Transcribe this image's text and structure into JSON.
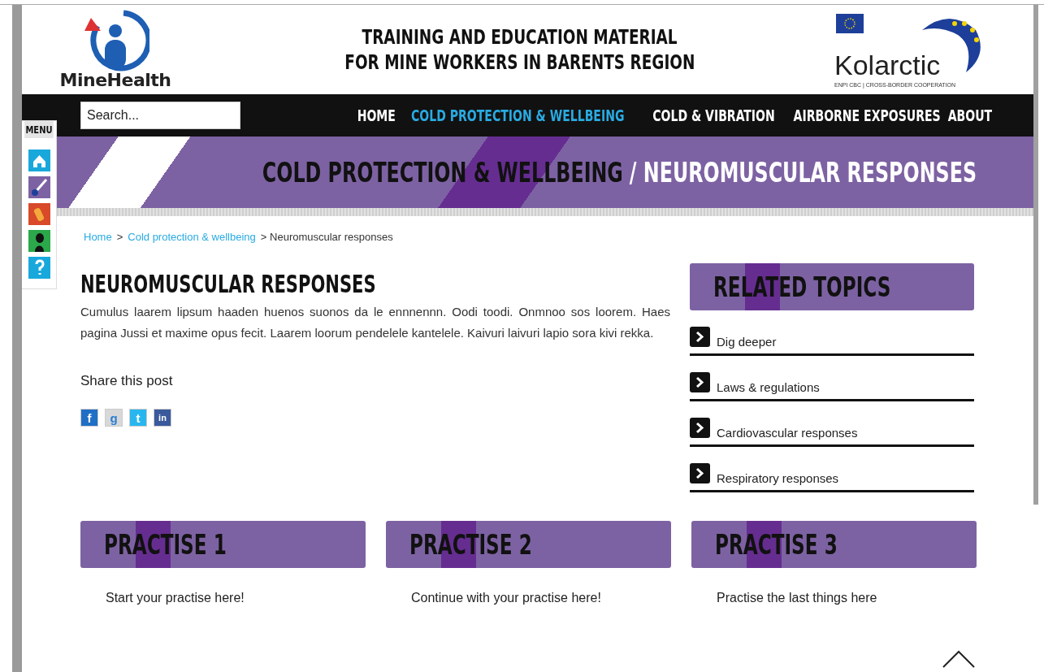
{
  "header": {
    "logo_text": "MineHealth",
    "title_lines": [
      "TRAINING AND EDUCATION MATERIAL",
      "FOR MINE WORKERS IN BARENTS REGION"
    ],
    "partner_logo_text": "Kolarctic",
    "partner_tagline": "ENPI CBC | CROSS-BORDER COOPERATION"
  },
  "search": {
    "placeholder": "Search..."
  },
  "nav": [
    {
      "label": "HOME",
      "selected": false
    },
    {
      "label": "COLD PROTECTION & WELLBEING",
      "selected": true
    },
    {
      "label": "COLD & VIBRATION",
      "selected": false
    },
    {
      "label": "AIRBORNE EXPOSURES",
      "selected": false
    },
    {
      "label": "ABOUT",
      "selected": false
    }
  ],
  "side_menu": {
    "label": "MENU"
  },
  "banner": {
    "parent": "COLD PROTECTION & WELLBEING",
    "current": "/ NEUROMUSCULAR RESPONSES"
  },
  "breadcrumb": [
    {
      "label": "Home",
      "kind": "link"
    },
    {
      "label": ">",
      "kind": "separator"
    },
    {
      "label": "Cold protection & wellbeing",
      "kind": "link"
    },
    {
      "label": "> Neuromuscular responses",
      "kind": "current"
    }
  ],
  "article": {
    "title": "NEUROMUSCULAR RESPONSES",
    "body": "Cumulus laarem lipsum haaden huenos suonos da le ennnennn. Oodi toodi. Onmnoo sos loorem. Haes pagina Jussi et maxime opus fecit. Laarem loorum pendelele kantelele. Kaivuri laivuri lapio sora kivi rekka.",
    "share_label": "Share this post",
    "share_buttons": [
      {
        "glyph": "f",
        "color": "#1f6fc5"
      },
      {
        "glyph": "g",
        "color": "#d8d8d8"
      },
      {
        "glyph": "t",
        "color": "#29b6ef"
      },
      {
        "glyph": "in",
        "color": "#3a5a9c"
      }
    ]
  },
  "related": {
    "title": "RELATED TOPICS",
    "items": [
      "Dig deeper",
      "Laws & regulations",
      "Cardiovascular responses",
      "Respiratory responses"
    ]
  },
  "practises": [
    {
      "title": "PRACTISE 1",
      "text": "Start your practise here!"
    },
    {
      "title": "PRACTISE 2",
      "text": "Continue with your practise here!"
    },
    {
      "title": "PRACTISE 3",
      "text": "Practise the last things here"
    }
  ]
}
